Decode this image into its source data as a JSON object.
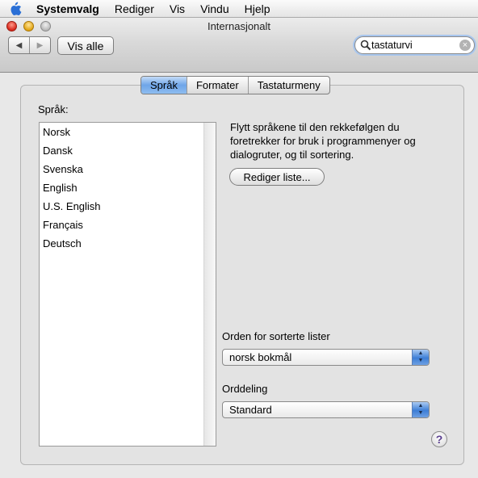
{
  "menubar": {
    "items": [
      "Systemvalg",
      "Rediger",
      "Vis",
      "Vindu",
      "Hjelp"
    ]
  },
  "window": {
    "title": "Internasjonalt",
    "show_all_label": "Vis alle",
    "search": {
      "value": "tastaturvi"
    }
  },
  "tabs": [
    {
      "label": "Språk",
      "active": true
    },
    {
      "label": "Formater",
      "active": false
    },
    {
      "label": "Tastaturmeny",
      "active": false
    }
  ],
  "languages": {
    "label": "Språk:",
    "items": [
      "Norsk",
      "Dansk",
      "Svenska",
      "English",
      "U.S. English",
      "Français",
      "Deutsch"
    ]
  },
  "description": "Flytt språkene til den rekkefølgen du foretrekker for bruk i programmenyer og dialogruter, og til sortering.",
  "edit_list_label": "Rediger liste...",
  "sort_order": {
    "label": "Orden for sorterte lister",
    "value": "norsk bokmål"
  },
  "hyphenation": {
    "label": "Orddeling",
    "value": "Standard"
  },
  "help_label": "?",
  "colors": {
    "selected_tab": "#6ea5e8",
    "popup_arrows": "#3d7ed6",
    "help_glyph": "#5a3e8f"
  }
}
